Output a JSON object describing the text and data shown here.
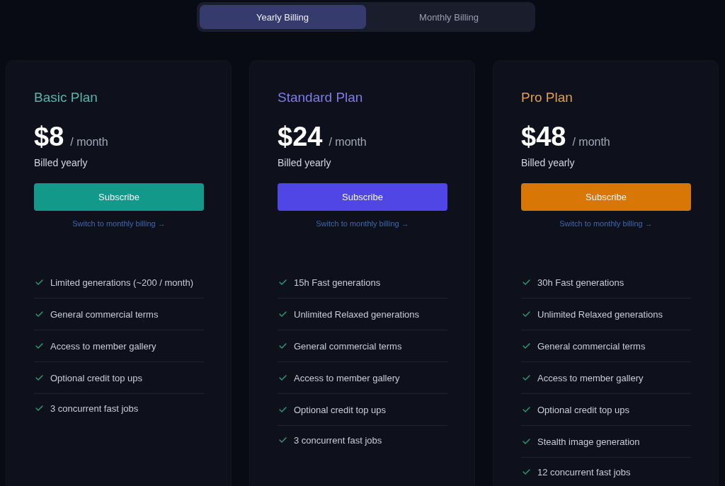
{
  "billing_toggle": [
    {
      "label": "Yearly Billing",
      "selected": true
    },
    {
      "label": "Monthly Billing",
      "selected": false
    }
  ],
  "plans": [
    {
      "name": "Basic Plan",
      "color": "#12998a",
      "price": "$8",
      "period": "/ month",
      "billing_note": "Billed yearly",
      "button": "Subscribe",
      "switch_link": "Switch to monthly billing →",
      "features": [
        "Limited generations (~200 / month)",
        "General commercial terms",
        "Access to member gallery",
        "Optional credit top ups",
        "3 concurrent fast jobs"
      ]
    },
    {
      "name": "Standard Plan",
      "color": "#5046e5",
      "price": "$24",
      "period": "/ month",
      "billing_note": "Billed yearly",
      "button": "Subscribe",
      "switch_link": "Switch to monthly billing →",
      "features": [
        "15h Fast generations",
        "Unlimited Relaxed generations",
        "General commercial terms",
        "Access to member gallery",
        "Optional credit top ups",
        "3 concurrent fast jobs"
      ]
    },
    {
      "name": "Pro Plan",
      "color": "#d97706",
      "price": "$48",
      "period": "/ month",
      "billing_note": "Billed yearly",
      "button": "Subscribe",
      "switch_link": "Switch to monthly billing →",
      "features": [
        "30h Fast generations",
        "Unlimited Relaxed generations",
        "General commercial terms",
        "Access to member gallery",
        "Optional credit top ups",
        "Stealth image generation",
        "12 concurrent fast jobs"
      ]
    }
  ]
}
